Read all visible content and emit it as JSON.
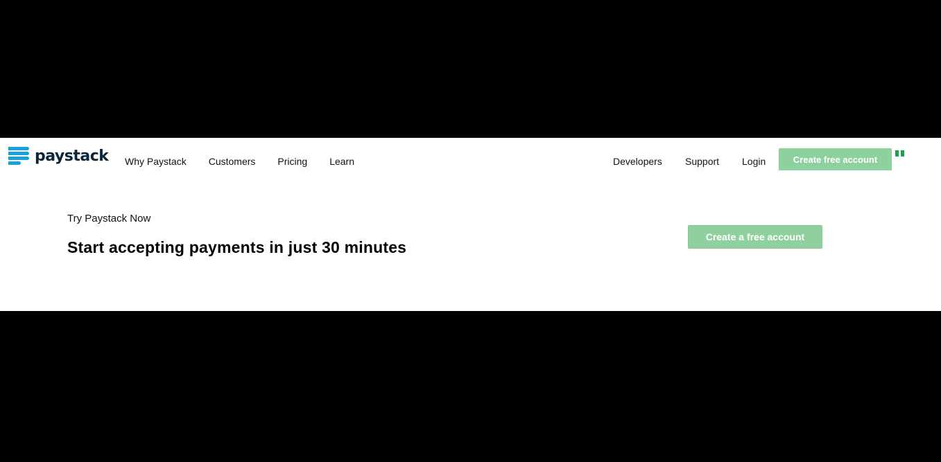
{
  "brand": {
    "name": "paystack",
    "logo_color": "#1aa1db",
    "text_color": "#0b2539"
  },
  "nav": {
    "left_links": [
      "Why Paystack",
      "Customers",
      "Pricing",
      "Learn"
    ],
    "right_links": [
      "Developers",
      "Support",
      "Login"
    ],
    "cta_label": "Create free account",
    "flag_icon": "nigeria-flag-icon"
  },
  "hero": {
    "eyebrow": "Try Paystack Now",
    "headline": "Start accepting payments in just 30 minutes",
    "cta_label": "Create a free account"
  },
  "colors": {
    "accent_green": "#8fd19e",
    "flag_green": "#17a34a"
  }
}
